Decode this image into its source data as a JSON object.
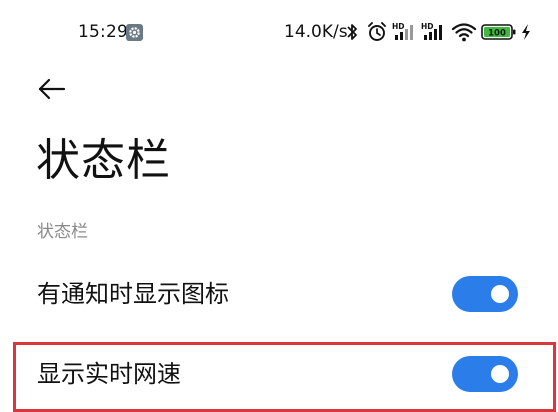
{
  "status_bar": {
    "time": "15:29",
    "net_speed": "14.0K/s",
    "hd_label_1": "HD",
    "hd_label_2": "HD",
    "battery_level": "100",
    "colors": {
      "battery_fill": "#3dbb3d",
      "gear_badge": "#6b7a86"
    }
  },
  "header": {
    "back_icon": "arrow-left-icon",
    "title": "状态栏"
  },
  "section": {
    "header": "状态栏",
    "items": [
      {
        "label": "有通知时显示图标",
        "toggle_on": true
      },
      {
        "label": "显示实时网速",
        "toggle_on": true
      }
    ]
  },
  "colors": {
    "accent": "#2b7de9",
    "highlight": "#d9363e",
    "section_header": "#8a8a8a"
  }
}
